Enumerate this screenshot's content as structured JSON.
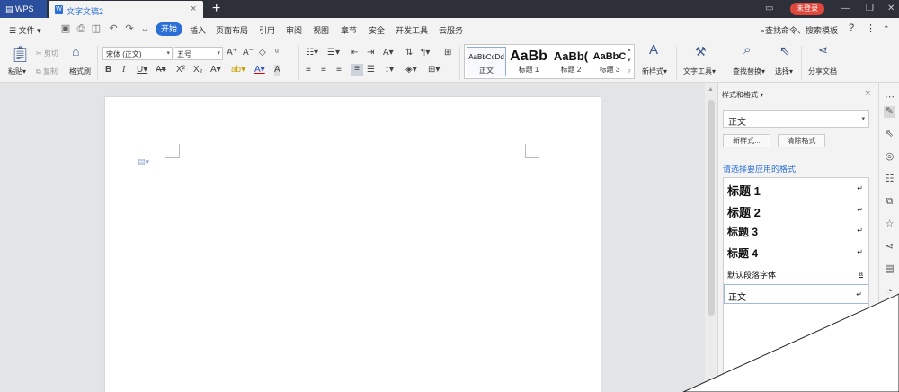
{
  "titlebar": {
    "app_tab": "WPS",
    "doc_tab": "文字文稿2",
    "login": "未登录"
  },
  "menu": {
    "file": "文件",
    "active": "开始",
    "items": [
      "插入",
      "页面布局",
      "引用",
      "审阅",
      "视图",
      "章节",
      "安全",
      "开发工具",
      "云服务"
    ],
    "search": "查找命令、搜索模板"
  },
  "ribbon": {
    "paste": "粘贴",
    "cut": "剪切",
    "copy": "复制",
    "format_painter": "格式刷",
    "font_name": "宋体 (正文)",
    "font_size": "五号",
    "styles": [
      {
        "sample": "AaBbCcDd",
        "name": "正文"
      },
      {
        "sample": "AaBb",
        "name": "标题 1"
      },
      {
        "sample": "AaBb(",
        "name": "标题 2"
      },
      {
        "sample": "AaBbC",
        "name": "标题 3"
      }
    ],
    "new_style": "新样式",
    "text_tools": "文字工具",
    "find_replace": "查找替换",
    "select": "选择",
    "share": "分享文档"
  },
  "panel": {
    "title": "样式和格式",
    "current_style": "正文",
    "new_style_btn": "新样式...",
    "clear_format_btn": "清除格式",
    "hint": "请选择要应用的格式",
    "styles": [
      {
        "label": "标题  1",
        "mark": "↵"
      },
      {
        "label": "标题  2",
        "mark": "↵"
      },
      {
        "label": "标题  3",
        "mark": "↵"
      },
      {
        "label": "标题  4",
        "mark": "↵"
      },
      {
        "label": "默认段落字体",
        "mark": "a"
      },
      {
        "label": "正文",
        "mark": "↵"
      }
    ]
  },
  "colors": {
    "accent": "#2b6fd6",
    "titlebar": "#2d3039",
    "login": "#e0473c"
  }
}
